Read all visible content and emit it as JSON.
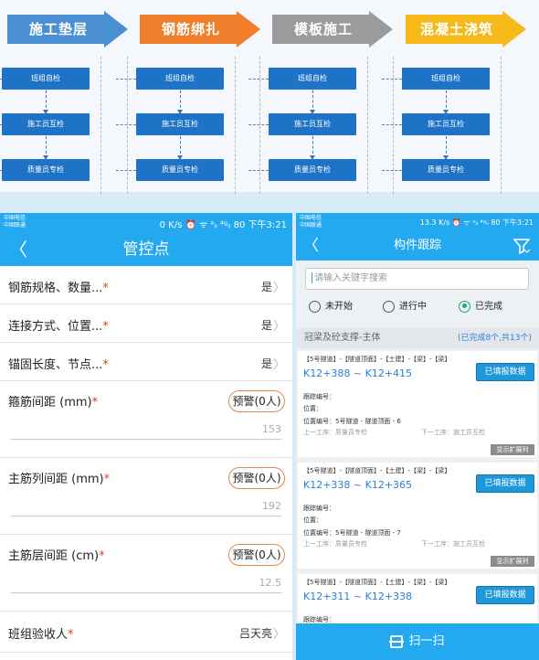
{
  "flow": {
    "stages": [
      {
        "label": "施工垫层",
        "color": "#4a8fd2"
      },
      {
        "label": "钢筋绑扎",
        "color": "#f07f2d"
      },
      {
        "label": "模板施工",
        "color": "#9c9c9c"
      },
      {
        "label": "混凝土浇筑",
        "color": "#f6b91a"
      }
    ],
    "steps": [
      "班组自检",
      "施工员互检",
      "质量员专检"
    ]
  },
  "left_phone": {
    "status": {
      "carrier1": "中国电信",
      "carrier2": "中国联通",
      "right": "0 K/s ⏰ ᯤ ᵃᵢₗ ⁴ᵍᵢₗ 80 下午3:21"
    },
    "title": "管控点",
    "back": "〈",
    "rows": [
      {
        "label": "钢筋规格、数量...",
        "value": "是"
      },
      {
        "label": "连接方式、位置...",
        "value": "是"
      },
      {
        "label": "锚固长度、节点...",
        "value": "是"
      }
    ],
    "warn_rows": [
      {
        "label": "箍筋间距 (mm)",
        "warn": "预警(0人)",
        "value": "153"
      },
      {
        "label": "主筋列间距 (mm)",
        "warn": "预警(0人)",
        "value": "192"
      },
      {
        "label": "主筋层间距 (cm)",
        "warn": "预警(0人)",
        "value": "12.5"
      }
    ],
    "last_row": {
      "label": "班组验收人",
      "value": "吕天亮"
    },
    "required_mark": "*",
    "chevron": "〉"
  },
  "right_phone": {
    "status": {
      "carrier1": "中国电信",
      "carrier2": "中国联通",
      "right": "13.3 K/s ⏰ ᯤ ᵃᵢₗ ⁴ᵍᵢₗ 80 下午3:21"
    },
    "title": "构件跟踪",
    "back": "〈",
    "search_placeholder": "请输入关键字搜索",
    "filters": [
      {
        "label": "未开始",
        "selected": false
      },
      {
        "label": "进行中",
        "selected": false
      },
      {
        "label": "已完成",
        "selected": true
      }
    ],
    "section_title": "冠梁及砼支撑-主体",
    "section_count": "(已完成8个,共13个)",
    "fill_label": "已填报数据",
    "expand_label": "显示扩展列",
    "code_label": "跟踪编号：",
    "pos_label": "位置：",
    "cards": [
      {
        "path": "【5号隧道】-【隧道顶面】-【土建】-【梁】-【梁】",
        "km": "K12+388 ~ K12+415",
        "pos_code": "位置编号：5号隧道 - 隧道顶面 - 6",
        "prev": "上一工序：质量员专检",
        "next": "下一工序：施工员互检"
      },
      {
        "path": "【5号隧道】-【隧道顶面】-【土建】-【梁】-【梁】",
        "km": "K12+338 ~ K12+365",
        "pos_code": "位置编号：5号隧道 - 隧道顶面 - 7",
        "prev": "上一工序：质量员专检",
        "next": "下一工序：施工员互检"
      },
      {
        "path": "【5号隧道】-【隧道顶面】-【土建】-【梁】-【梁】",
        "km": "K12+311 ~ K12+338"
      }
    ],
    "scan_label": "扫一扫"
  }
}
